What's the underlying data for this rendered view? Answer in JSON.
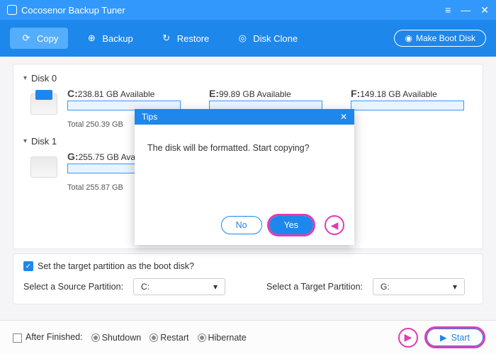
{
  "app": {
    "title": "Cocosenor Backup Tuner"
  },
  "toolbar": {
    "copy": "Copy",
    "backup": "Backup",
    "restore": "Restore",
    "diskclone": "Disk Clone",
    "bootdisk": "Make Boot Disk"
  },
  "disks": {
    "d0": {
      "name": "Disk 0",
      "c": {
        "letter": "C:",
        "avail": "238.81 GB Available"
      },
      "e": {
        "letter": "E:",
        "avail": "99.89 GB Available"
      },
      "f": {
        "letter": "F:",
        "avail": "149.18 GB Available"
      },
      "total": "Total 250.39 GB"
    },
    "d1": {
      "name": "Disk 1",
      "g": {
        "letter": "G:",
        "avail": "255.75 GB Available"
      },
      "total": "Total 255.87 GB"
    }
  },
  "options": {
    "bootcheck": "Set the target partition as the boot disk?",
    "source_lbl": "Select a Source Partition:",
    "source_val": "C:",
    "target_lbl": "Select a Target Partition:",
    "target_val": "G:"
  },
  "footer": {
    "after": "After Finished:",
    "shutdown": "Shutdown",
    "restart": "Restart",
    "hibernate": "Hibernate",
    "start": "Start"
  },
  "modal": {
    "title": "Tips",
    "msg": "The disk will be formatted. Start copying?",
    "no": "No",
    "yes": "Yes"
  }
}
